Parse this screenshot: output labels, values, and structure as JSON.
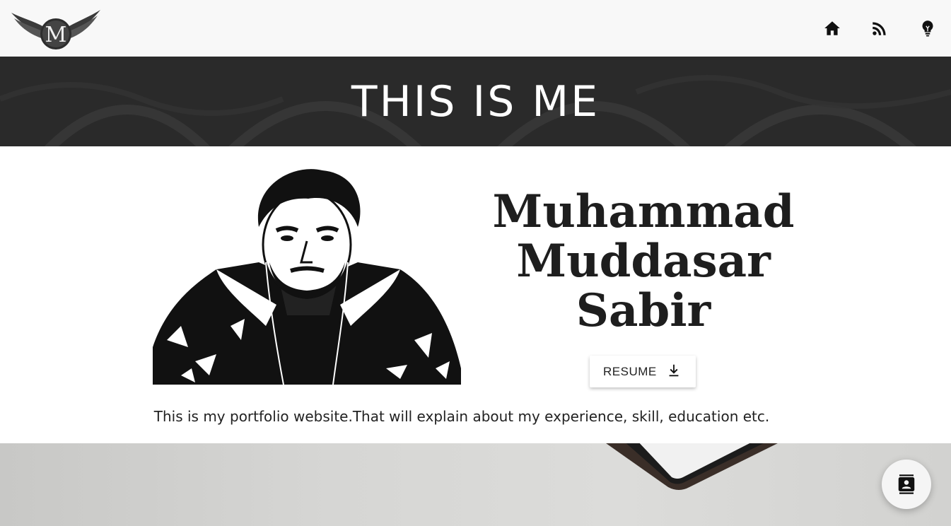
{
  "header": {
    "logo_letter": "M",
    "nav": [
      {
        "icon": "home-icon"
      },
      {
        "icon": "rss-feed-icon"
      },
      {
        "icon": "lightbulb-icon"
      }
    ]
  },
  "banner": {
    "title": "THIS IS ME"
  },
  "profile": {
    "name_lines": [
      "Muhammad",
      "Muddasar",
      "Sabir"
    ],
    "resume_label": "RESUME",
    "resume_icon": "download-icon",
    "intro": "This is my portfolio website.That will explain about my experience, skill, education etc."
  },
  "fab": {
    "icon": "contact-card-icon"
  },
  "colors": {
    "banner_bg": "#2a2a2a",
    "header_bg": "#f8f8f8",
    "text": "#1e1e1e"
  }
}
